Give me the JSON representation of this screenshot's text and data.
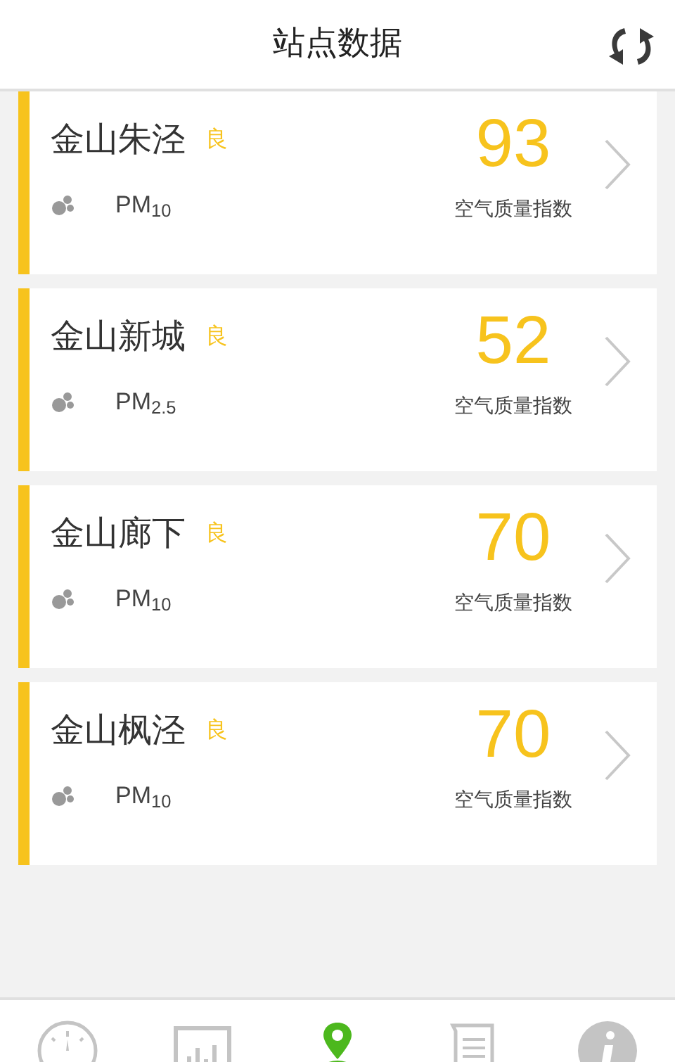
{
  "header": {
    "title": "站点数据"
  },
  "stations": [
    {
      "name": "金山朱泾",
      "grade": "良",
      "pollutant": "PM$_{10}$",
      "value": "93",
      "caption": "空气质量指数",
      "color": "#f7c31d"
    },
    {
      "name": "金山新城",
      "grade": "良",
      "pollutant": "PM$_{2.5}$",
      "value": "52",
      "caption": "空气质量指数",
      "color": "#f7c31d"
    },
    {
      "name": "金山廊下",
      "grade": "良",
      "pollutant": "PM$_{10}$",
      "value": "70",
      "caption": "空气质量指数",
      "color": "#f7c31d"
    },
    {
      "name": "金山枫泾",
      "grade": "良",
      "pollutant": "PM$_{10}$",
      "value": "70",
      "caption": "空气质量指数",
      "color": "#f7c31d"
    }
  ],
  "tabs": [
    {
      "kind": "gauge",
      "selected": false
    },
    {
      "kind": "chart",
      "selected": false
    },
    {
      "kind": "pin",
      "selected": true
    },
    {
      "kind": "scroll",
      "selected": false
    },
    {
      "kind": "info",
      "selected": false
    }
  ]
}
